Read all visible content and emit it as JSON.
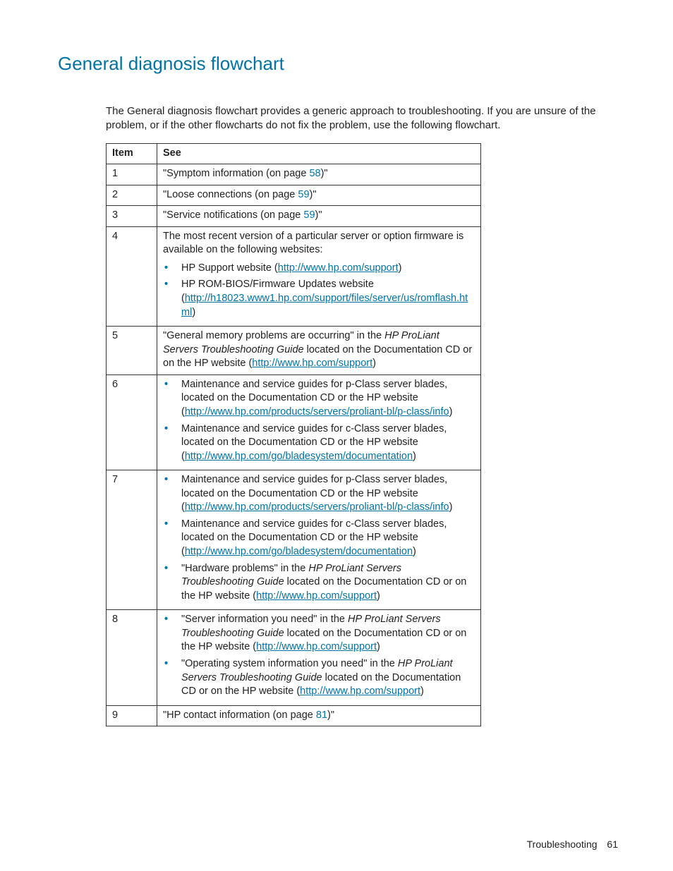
{
  "title": "General diagnosis flowchart",
  "intro": "The General diagnosis flowchart provides a generic approach to troubleshooting. If you are unsure of the problem, or if the other flowcharts do not fix the problem, use the following flowchart.",
  "headers": {
    "item": "Item",
    "see": "See"
  },
  "rows": {
    "r1": {
      "item": "1",
      "pre": "\"Symptom information (on page ",
      "page": "58",
      "post": ")\""
    },
    "r2": {
      "item": "2",
      "pre": "\"Loose connections (on page ",
      "page": "59",
      "post": ")\""
    },
    "r3": {
      "item": "3",
      "pre": "\"Service notifications (on page ",
      "page": "59",
      "post": ")\""
    },
    "r4": {
      "item": "4",
      "lead": "The most recent version of a particular server or option firmware is available on the following websites:",
      "b1_pre": "HP Support website (",
      "b1_link": "http://www.hp.com/support",
      "b1_post": ")",
      "b2_line1": "HP ROM-BIOS/Firmware Updates website",
      "b2_pre": "(",
      "b2_link": "http://h18023.www1.hp.com/support/files/server/us/romflash.html",
      "b2_post": ")"
    },
    "r5": {
      "item": "5",
      "pre": "\"General memory problems are occurring\" in the ",
      "ital": "HP ProLiant Servers Troubleshooting Guide",
      "mid": " located on the Documentation CD or on the HP website (",
      "link": "http://www.hp.com/support",
      "post": ")"
    },
    "r6": {
      "item": "6",
      "b1_text": "Maintenance and service guides for p-Class server blades, located on the Documentation CD or the HP website (",
      "b1_link": "http://www.hp.com/products/servers/proliant-bl/p-class/info",
      "b1_post": ")",
      "b2_text": "Maintenance and service guides for c-Class server blades, located on the Documentation CD or the HP website (",
      "b2_link": "http://www.hp.com/go/bladesystem/documentation",
      "b2_post": ")"
    },
    "r7": {
      "item": "7",
      "b1_text": "Maintenance and service guides for p-Class server blades, located on the Documentation CD or the HP website (",
      "b1_link": "http://www.hp.com/products/servers/proliant-bl/p-class/info",
      "b1_post": ")",
      "b2_text": "Maintenance and service guides for c-Class server blades, located on the Documentation CD or the HP website (",
      "b2_link": "http://www.hp.com/go/bladesystem/documentation",
      "b2_post": ")",
      "b3_pre": "\"Hardware problems\" in the ",
      "b3_ital": "HP ProLiant Servers Troubleshooting Guide",
      "b3_mid": " located on the Documentation CD or on the HP website (",
      "b3_link": "http://www.hp.com/support",
      "b3_post": ")"
    },
    "r8": {
      "item": "8",
      "b1_pre": "\"Server information you need\" in the ",
      "b1_ital": "HP ProLiant Servers Troubleshooting Guide",
      "b1_mid": " located on the Documentation CD or on the HP website (",
      "b1_link": "http://www.hp.com/support",
      "b1_post": ")",
      "b2_pre": "\"Operating system information you need\" in the ",
      "b2_ital": "HP ProLiant Servers Troubleshooting Guide",
      "b2_mid": " located on the Documentation CD or on the HP website (",
      "b2_link": "http://www.hp.com/support",
      "b2_post": ")"
    },
    "r9": {
      "item": "9",
      "pre": "\"HP contact information (on page ",
      "page": "81",
      "post": ")\""
    }
  },
  "footer": {
    "section": "Troubleshooting",
    "page": "61"
  }
}
